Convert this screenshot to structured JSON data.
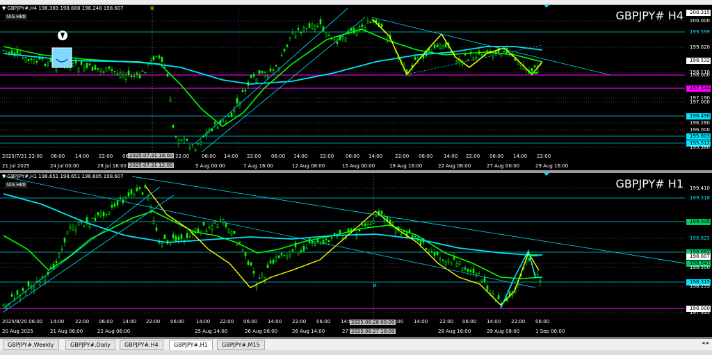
{
  "menubar": {
    "visible": true
  },
  "top_chart": {
    "header": "GBPJPY#,H4  198.369 198.688 198.248 198.607",
    "as_hidi": "!AS Hidi",
    "title": "GBPJPY# H4",
    "price_labels": [
      {
        "text": "200.315",
        "bg": "#ffffff",
        "fg": "#000000"
      },
      {
        "text": "200.000",
        "bg": "",
        "fg": "#ffffff"
      },
      {
        "text": "199.599",
        "bg": "",
        "fg": "#00e5ff"
      },
      {
        "text": "199.020",
        "bg": "",
        "fg": "#ffffff"
      },
      {
        "text": "198.532",
        "bg": "#ffffff",
        "fg": "#000000"
      },
      {
        "text": "198.110",
        "bg": "",
        "fg": "#ffffff"
      },
      {
        "text": "198.000",
        "bg": "",
        "fg": "#ffffff"
      },
      {
        "text": "197.544",
        "bg": "#ff00ff",
        "fg": "#000000"
      },
      {
        "text": "197.190",
        "bg": "",
        "fg": "#ffffff"
      },
      {
        "text": "197.000",
        "bg": "",
        "fg": "#ffffff"
      },
      {
        "text": "196.490",
        "bg": "#00e5ff",
        "fg": "#000000"
      },
      {
        "text": "196.280",
        "bg": "",
        "fg": "#ffffff"
      },
      {
        "text": "196.000",
        "bg": "",
        "fg": "#ffffff"
      },
      {
        "text": "195.803",
        "bg": "#00e5ff",
        "fg": "#000000"
      },
      {
        "text": "195.512",
        "bg": "#00e5ff",
        "fg": "#000000"
      },
      {
        "text": "195.380",
        "bg": "",
        "fg": "#ffffff"
      }
    ],
    "time_labels": [
      "2025/7/21 22:00",
      "06:00",
      "14:00",
      "22:00",
      "06:00",
      "14:00",
      "22:00",
      "06:00",
      "14:00",
      "22:00",
      "06:00",
      "14:00",
      "22:00",
      "06:00",
      "14:00",
      "22:00",
      "06:00",
      "14:00",
      "22:00",
      "06:00",
      "14:00",
      "22:00"
    ],
    "date_labels": [
      "21 Jul 2025",
      "24 Jul 00:00",
      "28 Jul 16:00",
      "5 Aug 00:00",
      "7 Aug 16:00",
      "12 Aug 08:00",
      "15 Aug 00:00",
      "19 Aug 16:00",
      "22 Aug 08:00",
      "27 Aug 00:00",
      "29 Aug 16:00"
    ],
    "time_boxes": [
      "2025.07.31 18:00",
      "2025.07.31 12:00"
    ]
  },
  "bottom_chart": {
    "header": "GBPJPY#,H1  198.651 198.651 198.605 198.607",
    "as_hidi": "!AS Hidi",
    "title": "GBPJPY# H1",
    "price_labels": [
      {
        "text": "199.410",
        "bg": "",
        "fg": "#ffffff"
      },
      {
        "text": "199.318",
        "bg": "",
        "fg": "#00e5ff"
      },
      {
        "text": "199.035",
        "bg": "#00cc66",
        "fg": "#000000"
      },
      {
        "text": "198.825",
        "bg": "",
        "fg": "#00e5ff"
      },
      {
        "text": "198.662",
        "bg": "#00cc66",
        "fg": "#000000"
      },
      {
        "text": "198.607",
        "bg": "#ffffff",
        "fg": "#000000"
      },
      {
        "text": "198.541",
        "bg": "#00cc66",
        "fg": "#000000"
      },
      {
        "text": "198.500",
        "bg": "",
        "fg": "#ffffff"
      },
      {
        "text": "198.315",
        "bg": "#00e5ff",
        "fg": "#000000"
      },
      {
        "text": "198.255",
        "bg": "",
        "fg": "#ffffff"
      },
      {
        "text": "198.000",
        "bg": "#ffffff",
        "fg": "#000000"
      },
      {
        "text": "197.935",
        "bg": "",
        "fg": "#ffffff"
      }
    ],
    "time_labels": [
      "2025/8/20 06:00",
      "14:00",
      "22:00",
      "06:00",
      "14:00",
      "22:00",
      "06:00",
      "14:00",
      "22:00",
      "06:00",
      "14:00",
      "22:00",
      "06:00",
      "14:00",
      "22:00",
      "06:00",
      "14:00",
      "22:00",
      "06:00",
      "14:00",
      "22:00",
      "06:00"
    ],
    "date_labels": [
      "20 Aug 2025",
      "21 Aug 06:00",
      "22 Aug 06:00",
      "25 Aug 14:00",
      "26 Aug 06:00",
      "26 Aug 14:00",
      "27",
      "28 Aug 16:00",
      "29 Aug 08:00",
      "1 Sep 00:00"
    ],
    "time_boxes": [
      "2025.08.28 00:00",
      "2025.08.27 18:00"
    ]
  },
  "tabs": [
    {
      "label": "GBPJPY#,Weekly",
      "active": false
    },
    {
      "label": "GBPJPY#,Daily",
      "active": false
    },
    {
      "label": "GBPJPY#,H4",
      "active": false
    },
    {
      "label": "GBPJPY#,H1",
      "active": true
    },
    {
      "label": "GBPJPY#,M15",
      "active": false
    }
  ],
  "colors": {
    "bull": "#00ff00",
    "bear": "#00ff00",
    "ma_fast": "#00ff00",
    "ma_slow": "#00e5ff",
    "zigzag": "#ffff00",
    "trend": "#00e5ff",
    "level": "#ff00ff"
  }
}
